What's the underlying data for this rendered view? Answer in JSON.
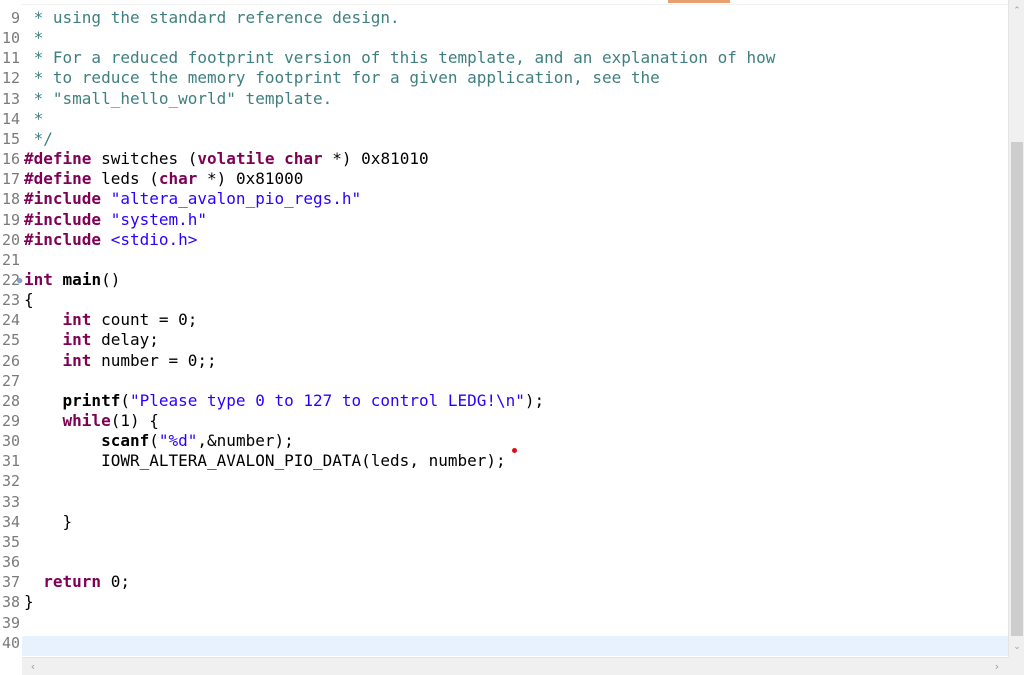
{
  "editor": {
    "lines": [
      {
        "no": "9",
        "parts": [
          {
            "c": "comment",
            "t": " * using the standard reference design."
          }
        ]
      },
      {
        "no": "10",
        "parts": [
          {
            "c": "comment",
            "t": " *"
          }
        ]
      },
      {
        "no": "11",
        "parts": [
          {
            "c": "comment",
            "t": " * For a reduced footprint version of this template, and an explanation of how"
          }
        ]
      },
      {
        "no": "12",
        "parts": [
          {
            "c": "comment",
            "t": " * to reduce the memory footprint for a given application, see the"
          }
        ]
      },
      {
        "no": "13",
        "parts": [
          {
            "c": "comment",
            "t": " * \"small_hello_world\" template."
          }
        ]
      },
      {
        "no": "14",
        "parts": [
          {
            "c": "comment",
            "t": " *"
          }
        ]
      },
      {
        "no": "15",
        "parts": [
          {
            "c": "comment",
            "t": " */"
          }
        ]
      },
      {
        "no": "16",
        "parts": [
          {
            "c": "kw",
            "t": "#define"
          },
          {
            "c": "plain",
            "t": " switches ("
          },
          {
            "c": "kw",
            "t": "volatile char"
          },
          {
            "c": "plain",
            "t": " *) 0x81010"
          }
        ]
      },
      {
        "no": "17",
        "parts": [
          {
            "c": "kw",
            "t": "#define"
          },
          {
            "c": "plain",
            "t": " leds ("
          },
          {
            "c": "kw",
            "t": "char"
          },
          {
            "c": "plain",
            "t": " *) 0x81000"
          }
        ]
      },
      {
        "no": "18",
        "parts": [
          {
            "c": "kw",
            "t": "#include"
          },
          {
            "c": "plain",
            "t": " "
          },
          {
            "c": "str",
            "t": "\"altera_avalon_pio_regs.h\""
          }
        ]
      },
      {
        "no": "19",
        "parts": [
          {
            "c": "kw",
            "t": "#include"
          },
          {
            "c": "plain",
            "t": " "
          },
          {
            "c": "str",
            "t": "\"system.h\""
          }
        ]
      },
      {
        "no": "20",
        "parts": [
          {
            "c": "kw",
            "t": "#include"
          },
          {
            "c": "plain",
            "t": " "
          },
          {
            "c": "str",
            "t": "<stdio.h>"
          }
        ]
      },
      {
        "no": "21",
        "parts": [
          {
            "c": "plain",
            "t": ""
          }
        ]
      },
      {
        "no": "22",
        "parts": [
          {
            "c": "kw",
            "t": "int"
          },
          {
            "c": "plain",
            "t": " "
          },
          {
            "c": "fn",
            "t": "main"
          },
          {
            "c": "plain",
            "t": "()"
          }
        ]
      },
      {
        "no": "23",
        "parts": [
          {
            "c": "plain",
            "t": "{"
          }
        ]
      },
      {
        "no": "24",
        "parts": [
          {
            "c": "plain",
            "t": "    "
          },
          {
            "c": "kw",
            "t": "int"
          },
          {
            "c": "plain",
            "t": " count = 0;"
          }
        ]
      },
      {
        "no": "25",
        "parts": [
          {
            "c": "plain",
            "t": "    "
          },
          {
            "c": "kw",
            "t": "int"
          },
          {
            "c": "plain",
            "t": " delay;"
          }
        ]
      },
      {
        "no": "26",
        "parts": [
          {
            "c": "plain",
            "t": "    "
          },
          {
            "c": "kw",
            "t": "int"
          },
          {
            "c": "plain",
            "t": " number = 0;;"
          }
        ]
      },
      {
        "no": "27",
        "parts": [
          {
            "c": "plain",
            "t": ""
          }
        ]
      },
      {
        "no": "28",
        "parts": [
          {
            "c": "plain",
            "t": "    "
          },
          {
            "c": "fn",
            "t": "printf"
          },
          {
            "c": "plain",
            "t": "("
          },
          {
            "c": "str",
            "t": "\"Please type 0 to 127 to control LEDG!\\n\""
          },
          {
            "c": "plain",
            "t": ");"
          }
        ]
      },
      {
        "no": "29",
        "parts": [
          {
            "c": "plain",
            "t": "    "
          },
          {
            "c": "kw",
            "t": "while"
          },
          {
            "c": "plain",
            "t": "(1) {"
          }
        ]
      },
      {
        "no": "30",
        "parts": [
          {
            "c": "plain",
            "t": "        "
          },
          {
            "c": "fn",
            "t": "scanf"
          },
          {
            "c": "plain",
            "t": "("
          },
          {
            "c": "str",
            "t": "\"%d\""
          },
          {
            "c": "plain",
            "t": ",&number);"
          }
        ]
      },
      {
        "no": "31",
        "parts": [
          {
            "c": "plain",
            "t": "        IOWR_ALTERA_AVALON_PIO_DATA(leds, number);"
          }
        ]
      },
      {
        "no": "32",
        "parts": [
          {
            "c": "plain",
            "t": ""
          }
        ]
      },
      {
        "no": "33",
        "parts": [
          {
            "c": "plain",
            "t": ""
          }
        ]
      },
      {
        "no": "34",
        "parts": [
          {
            "c": "plain",
            "t": "    }"
          }
        ]
      },
      {
        "no": "35",
        "parts": [
          {
            "c": "plain",
            "t": ""
          }
        ]
      },
      {
        "no": "36",
        "parts": [
          {
            "c": "plain",
            "t": ""
          }
        ]
      },
      {
        "no": "37",
        "parts": [
          {
            "c": "plain",
            "t": "  "
          },
          {
            "c": "kw",
            "t": "return"
          },
          {
            "c": "plain",
            "t": " 0;"
          }
        ]
      },
      {
        "no": "38",
        "parts": [
          {
            "c": "plain",
            "t": "}"
          }
        ]
      },
      {
        "no": "39",
        "parts": [
          {
            "c": "plain",
            "t": ""
          }
        ]
      },
      {
        "no": "40",
        "parts": [
          {
            "c": "plain",
            "t": ""
          }
        ]
      }
    ]
  },
  "colors": {
    "comment": "#3f7f7f",
    "keyword": "#7f0055",
    "string": "#2a00ff",
    "current_line": "#e8f2fe"
  },
  "icons": {
    "scroll_up": "chevron-up-icon",
    "scroll_down": "chevron-down-icon",
    "scroll_left": "chevron-left-icon",
    "scroll_right": "chevron-right-icon",
    "fold": "fold-marker-icon"
  }
}
